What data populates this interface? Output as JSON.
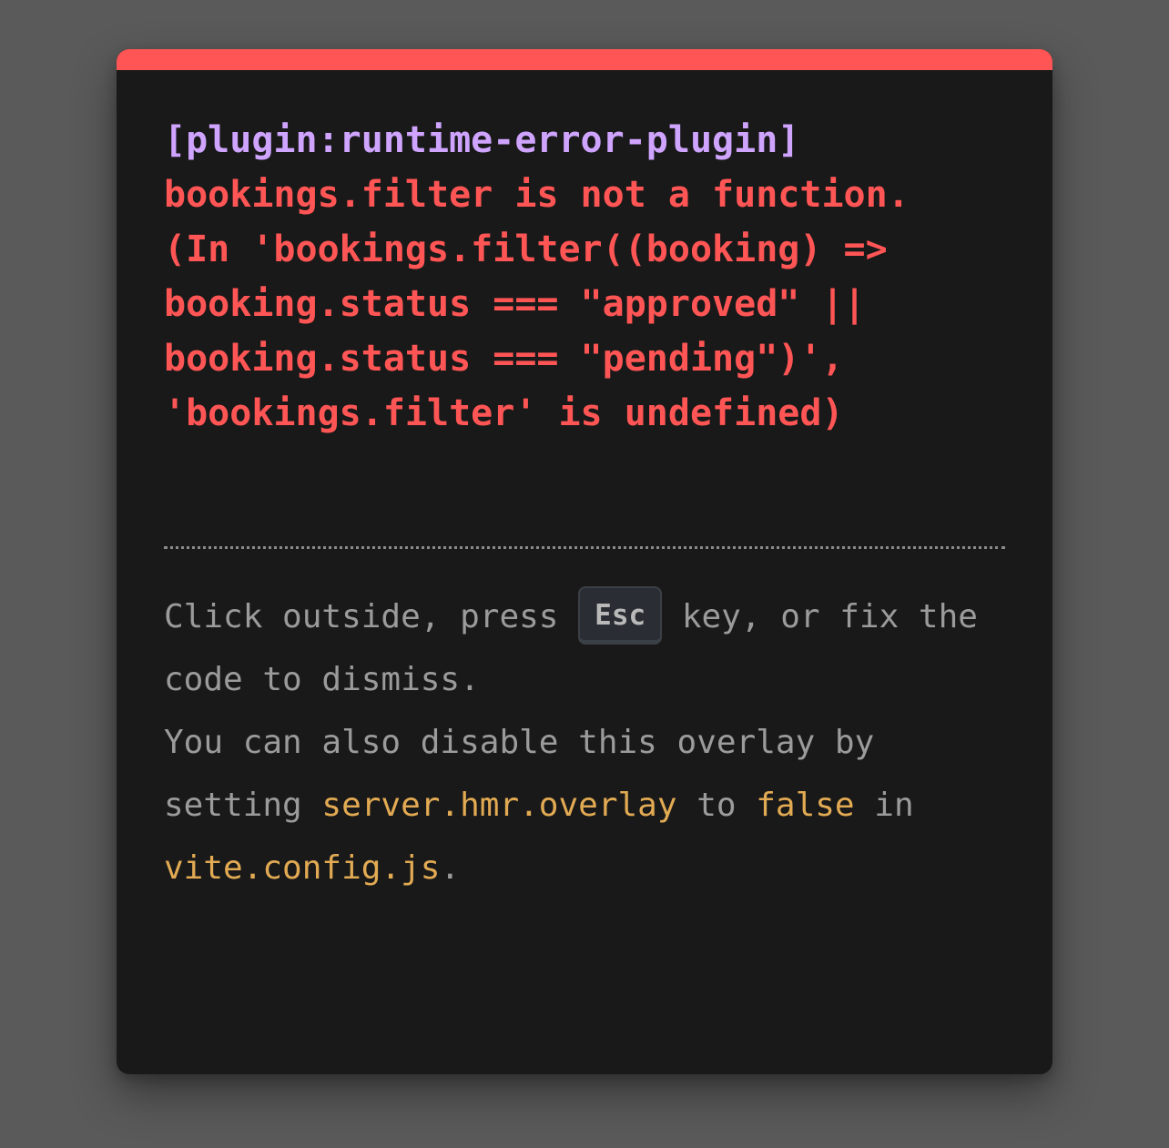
{
  "overlay": {
    "plugin": "[plugin:runtime-error-plugin]",
    "message": "bookings.filter is not a function. (In 'bookings.filter((booking) => booking.status === \"approved\" || booking.status === \"pending\")', 'bookings.filter' is undefined)",
    "tip": {
      "line1_before": "Click outside, press ",
      "key": "Esc",
      "line1_after": " key, or fix the code to dismiss.",
      "line2_before": "You can also disable this overlay by setting ",
      "config_option": "server.hmr.overlay",
      "line2_mid1": " to ",
      "config_value": "false",
      "line2_mid2": " in ",
      "config_file": "vite.config.js",
      "line2_end": "."
    }
  },
  "colors": {
    "background": "#5a5a5a",
    "card": "#191919",
    "accent_bar": "#ff5555",
    "error_text": "#ff5555",
    "plugin_text": "#cfa4ff",
    "tip_text": "#9b9b9b",
    "code_highlight": "#e2aa53"
  }
}
